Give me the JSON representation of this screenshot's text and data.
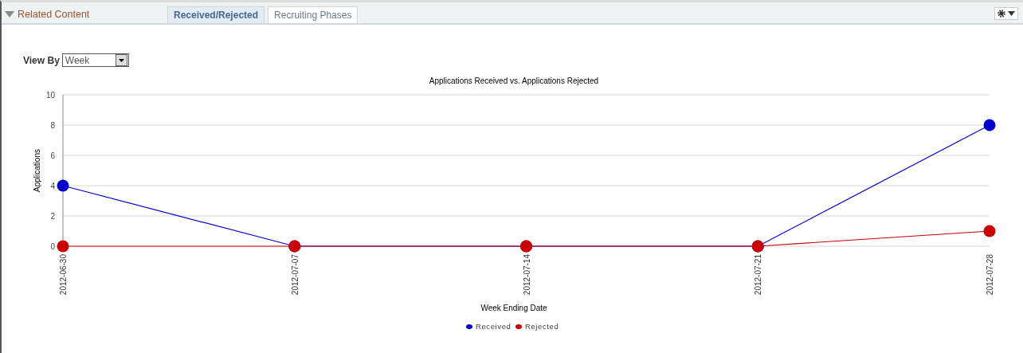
{
  "header": {
    "title": "Related Content",
    "expanded": true
  },
  "tabs": [
    {
      "label": "Received/Rejected",
      "selected": true
    },
    {
      "label": "Recruiting Phases",
      "selected": false
    }
  ],
  "view_by": {
    "label": "View By",
    "value": "Week"
  },
  "chart_data": {
    "type": "line",
    "title": "Applications Received vs. Applications Rejected",
    "xlabel": "Week Ending Date",
    "ylabel": "Applications",
    "categories": [
      "2012-06-30",
      "2012-07-07",
      "2012-07-14",
      "2012-07-21",
      "2012-07-28"
    ],
    "series": [
      {
        "name": "Received",
        "color": "#0000cc",
        "marker": "circle",
        "values": [
          4,
          0,
          0,
          0,
          8
        ]
      },
      {
        "name": "Rejected",
        "color": "#cc0000",
        "marker": "circle",
        "values": [
          0,
          0,
          0,
          0,
          1
        ]
      }
    ],
    "grid": true,
    "legend": true,
    "ylim": [
      0,
      10
    ],
    "yticks": [
      0,
      2,
      4,
      6,
      8,
      10
    ]
  }
}
